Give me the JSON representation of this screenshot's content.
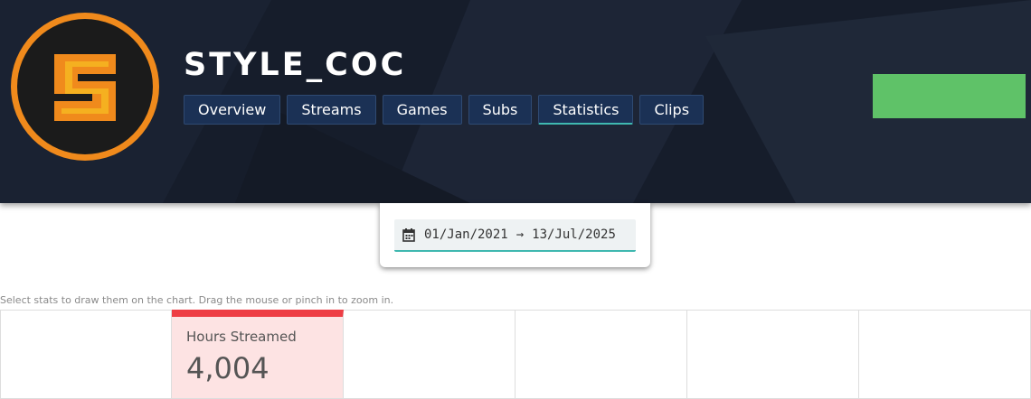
{
  "channel": {
    "name": "STYLE_COC"
  },
  "tabs": [
    {
      "label": "Overview"
    },
    {
      "label": "Streams"
    },
    {
      "label": "Games"
    },
    {
      "label": "Subs"
    },
    {
      "label": "Statistics",
      "active": true
    },
    {
      "label": "Clips"
    }
  ],
  "date_range": {
    "start": "01/Jan/2021",
    "arrow": "→",
    "end": "13/Jul/2025"
  },
  "hint": "Select stats to draw them on the chart. Drag the mouse or pinch in to zoom in.",
  "stats": [
    {
      "label": "",
      "value": ""
    },
    {
      "label": "Hours Streamed",
      "value": "4,004",
      "selected": true
    },
    {
      "label": "",
      "value": ""
    },
    {
      "label": "",
      "value": ""
    },
    {
      "label": "",
      "value": ""
    },
    {
      "label": "",
      "value": ""
    }
  ],
  "colors": {
    "header_bg": "#161d2b",
    "tab_bg": "#1b3155",
    "active_accent": "#3fb8b0",
    "green_button": "#5fc268",
    "selected_stat_bar": "#ee3d44",
    "selected_stat_bg": "#fde3e3",
    "logo_orange": "#f08a1c"
  },
  "icons": {
    "avatar": "logo-s-icon",
    "date": "calendar-icon"
  }
}
